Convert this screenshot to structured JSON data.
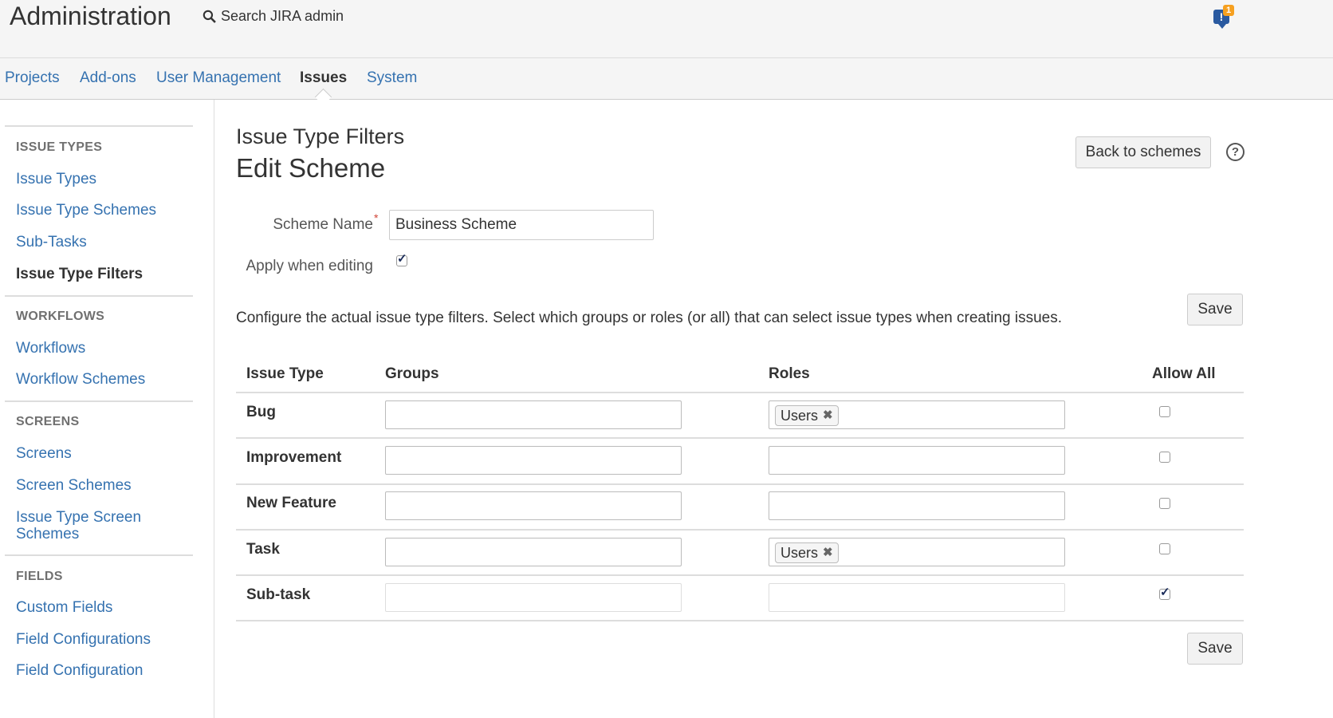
{
  "header": {
    "title": "Administration",
    "search_label": "Search JIRA admin",
    "notification_count": "1"
  },
  "nav": {
    "tabs": [
      {
        "label": "Projects",
        "active": false
      },
      {
        "label": "Add-ons",
        "active": false
      },
      {
        "label": "User Management",
        "active": false
      },
      {
        "label": "Issues",
        "active": true
      },
      {
        "label": "System",
        "active": false
      }
    ]
  },
  "sidebar": {
    "sections": [
      {
        "heading": "ISSUE TYPES",
        "items": [
          "Issue Types",
          "Issue Type Schemes",
          "Sub-Tasks",
          "Issue Type Filters"
        ]
      },
      {
        "heading": "WORKFLOWS",
        "items": [
          "Workflows",
          "Workflow Schemes"
        ]
      },
      {
        "heading": "SCREENS",
        "items": [
          "Screens",
          "Screen Schemes",
          "Issue Type Screen Schemes"
        ]
      },
      {
        "heading": "FIELDS",
        "items": [
          "Custom Fields",
          "Field Configurations",
          "Field Configuration"
        ]
      }
    ],
    "active_item": "Issue Type Filters"
  },
  "page": {
    "subtitle": "Issue Type Filters",
    "title": "Edit Scheme",
    "back_button": "Back to schemes",
    "help_icon": "?",
    "save_label": "Save",
    "description": "Configure the actual issue type filters. Select which groups or roles (or all) that can select issue types when creating issues."
  },
  "form": {
    "scheme_name_label": "Scheme Name",
    "required_marker": "*",
    "scheme_name_value": "Business Scheme",
    "apply_label": "Apply when editing",
    "apply_checked": true
  },
  "table": {
    "headers": {
      "issue_type": "Issue Type",
      "groups": "Groups",
      "roles": "Roles",
      "allow_all": "Allow All"
    },
    "rows": [
      {
        "issue_type": "Bug",
        "groups": [],
        "roles": [
          "Users"
        ],
        "allow_all": false
      },
      {
        "issue_type": "Improvement",
        "groups": [],
        "roles": [],
        "allow_all": false
      },
      {
        "issue_type": "New Feature",
        "groups": [],
        "roles": [],
        "allow_all": false
      },
      {
        "issue_type": "Task",
        "groups": [],
        "roles": [
          "Users"
        ],
        "allow_all": false
      },
      {
        "issue_type": "Sub-task",
        "groups": [],
        "roles": [],
        "allow_all": true
      }
    ]
  },
  "icons": {
    "search": "search-icon",
    "notification": "feedback-icon",
    "help": "help-icon",
    "tag_remove": "close-icon"
  },
  "colors": {
    "link": "#3572b0",
    "header_bg": "#f5f5f5",
    "required": "#d04437"
  }
}
